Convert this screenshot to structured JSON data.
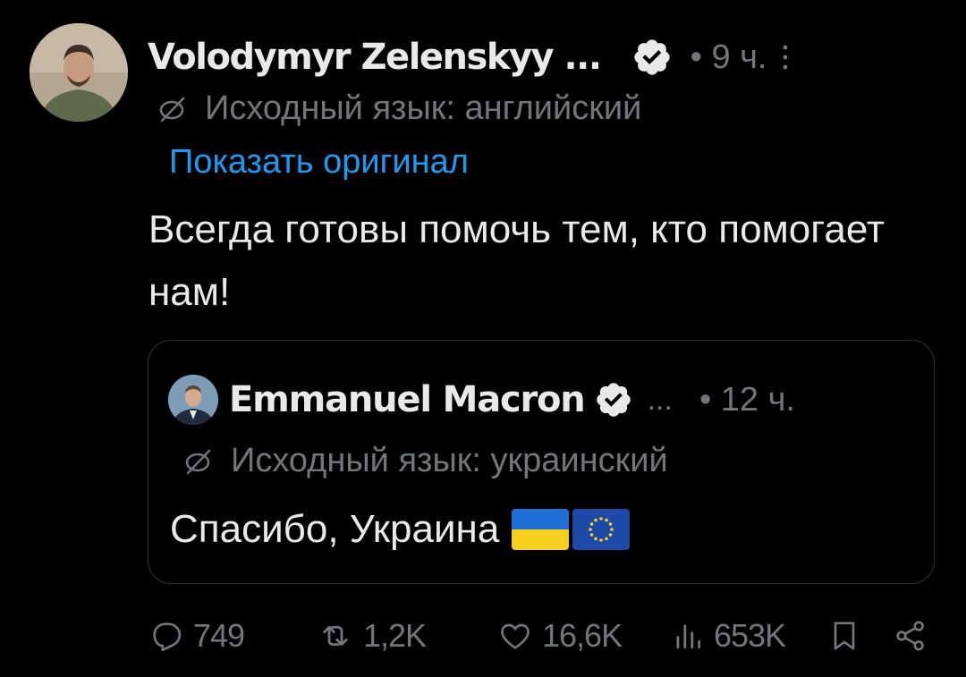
{
  "tweet": {
    "author_name": "Volodymyr Zelenskyy ...",
    "separator_time": "• 9 ч.",
    "translation_note": "Исходный язык: английский",
    "show_original": "Показать оригинал",
    "text": "Всегда готовы помочь тем, кто помогает нам!"
  },
  "quoted_tweet": {
    "author_name": "Emmanuel Macron",
    "ellipsis": "...",
    "separator_time": "• 12 ч.",
    "translation_note": "Исходный язык: украинский",
    "text": "Спасибо, Украина"
  },
  "actions": {
    "replies": "749",
    "retweets": "1,2K",
    "likes": "16,6K",
    "views": "653K"
  },
  "colors": {
    "background": "#000000",
    "primary_text": "#e7e9ea",
    "secondary_text": "#71767b",
    "link": "#1d9bf0",
    "border": "#2f3336",
    "verified_badge": "#e7e9ea"
  },
  "icons": {
    "verified": "verified-badge-icon",
    "more": "more-vertical-icon",
    "translate": "translate-icon",
    "reply": "reply-icon",
    "retweet": "retweet-icon",
    "like": "heart-icon",
    "views": "views-chart-icon",
    "bookmark": "bookmark-icon",
    "share": "share-icon",
    "flag_ua": "flag-ukraine-icon",
    "flag_eu": "flag-eu-icon"
  }
}
